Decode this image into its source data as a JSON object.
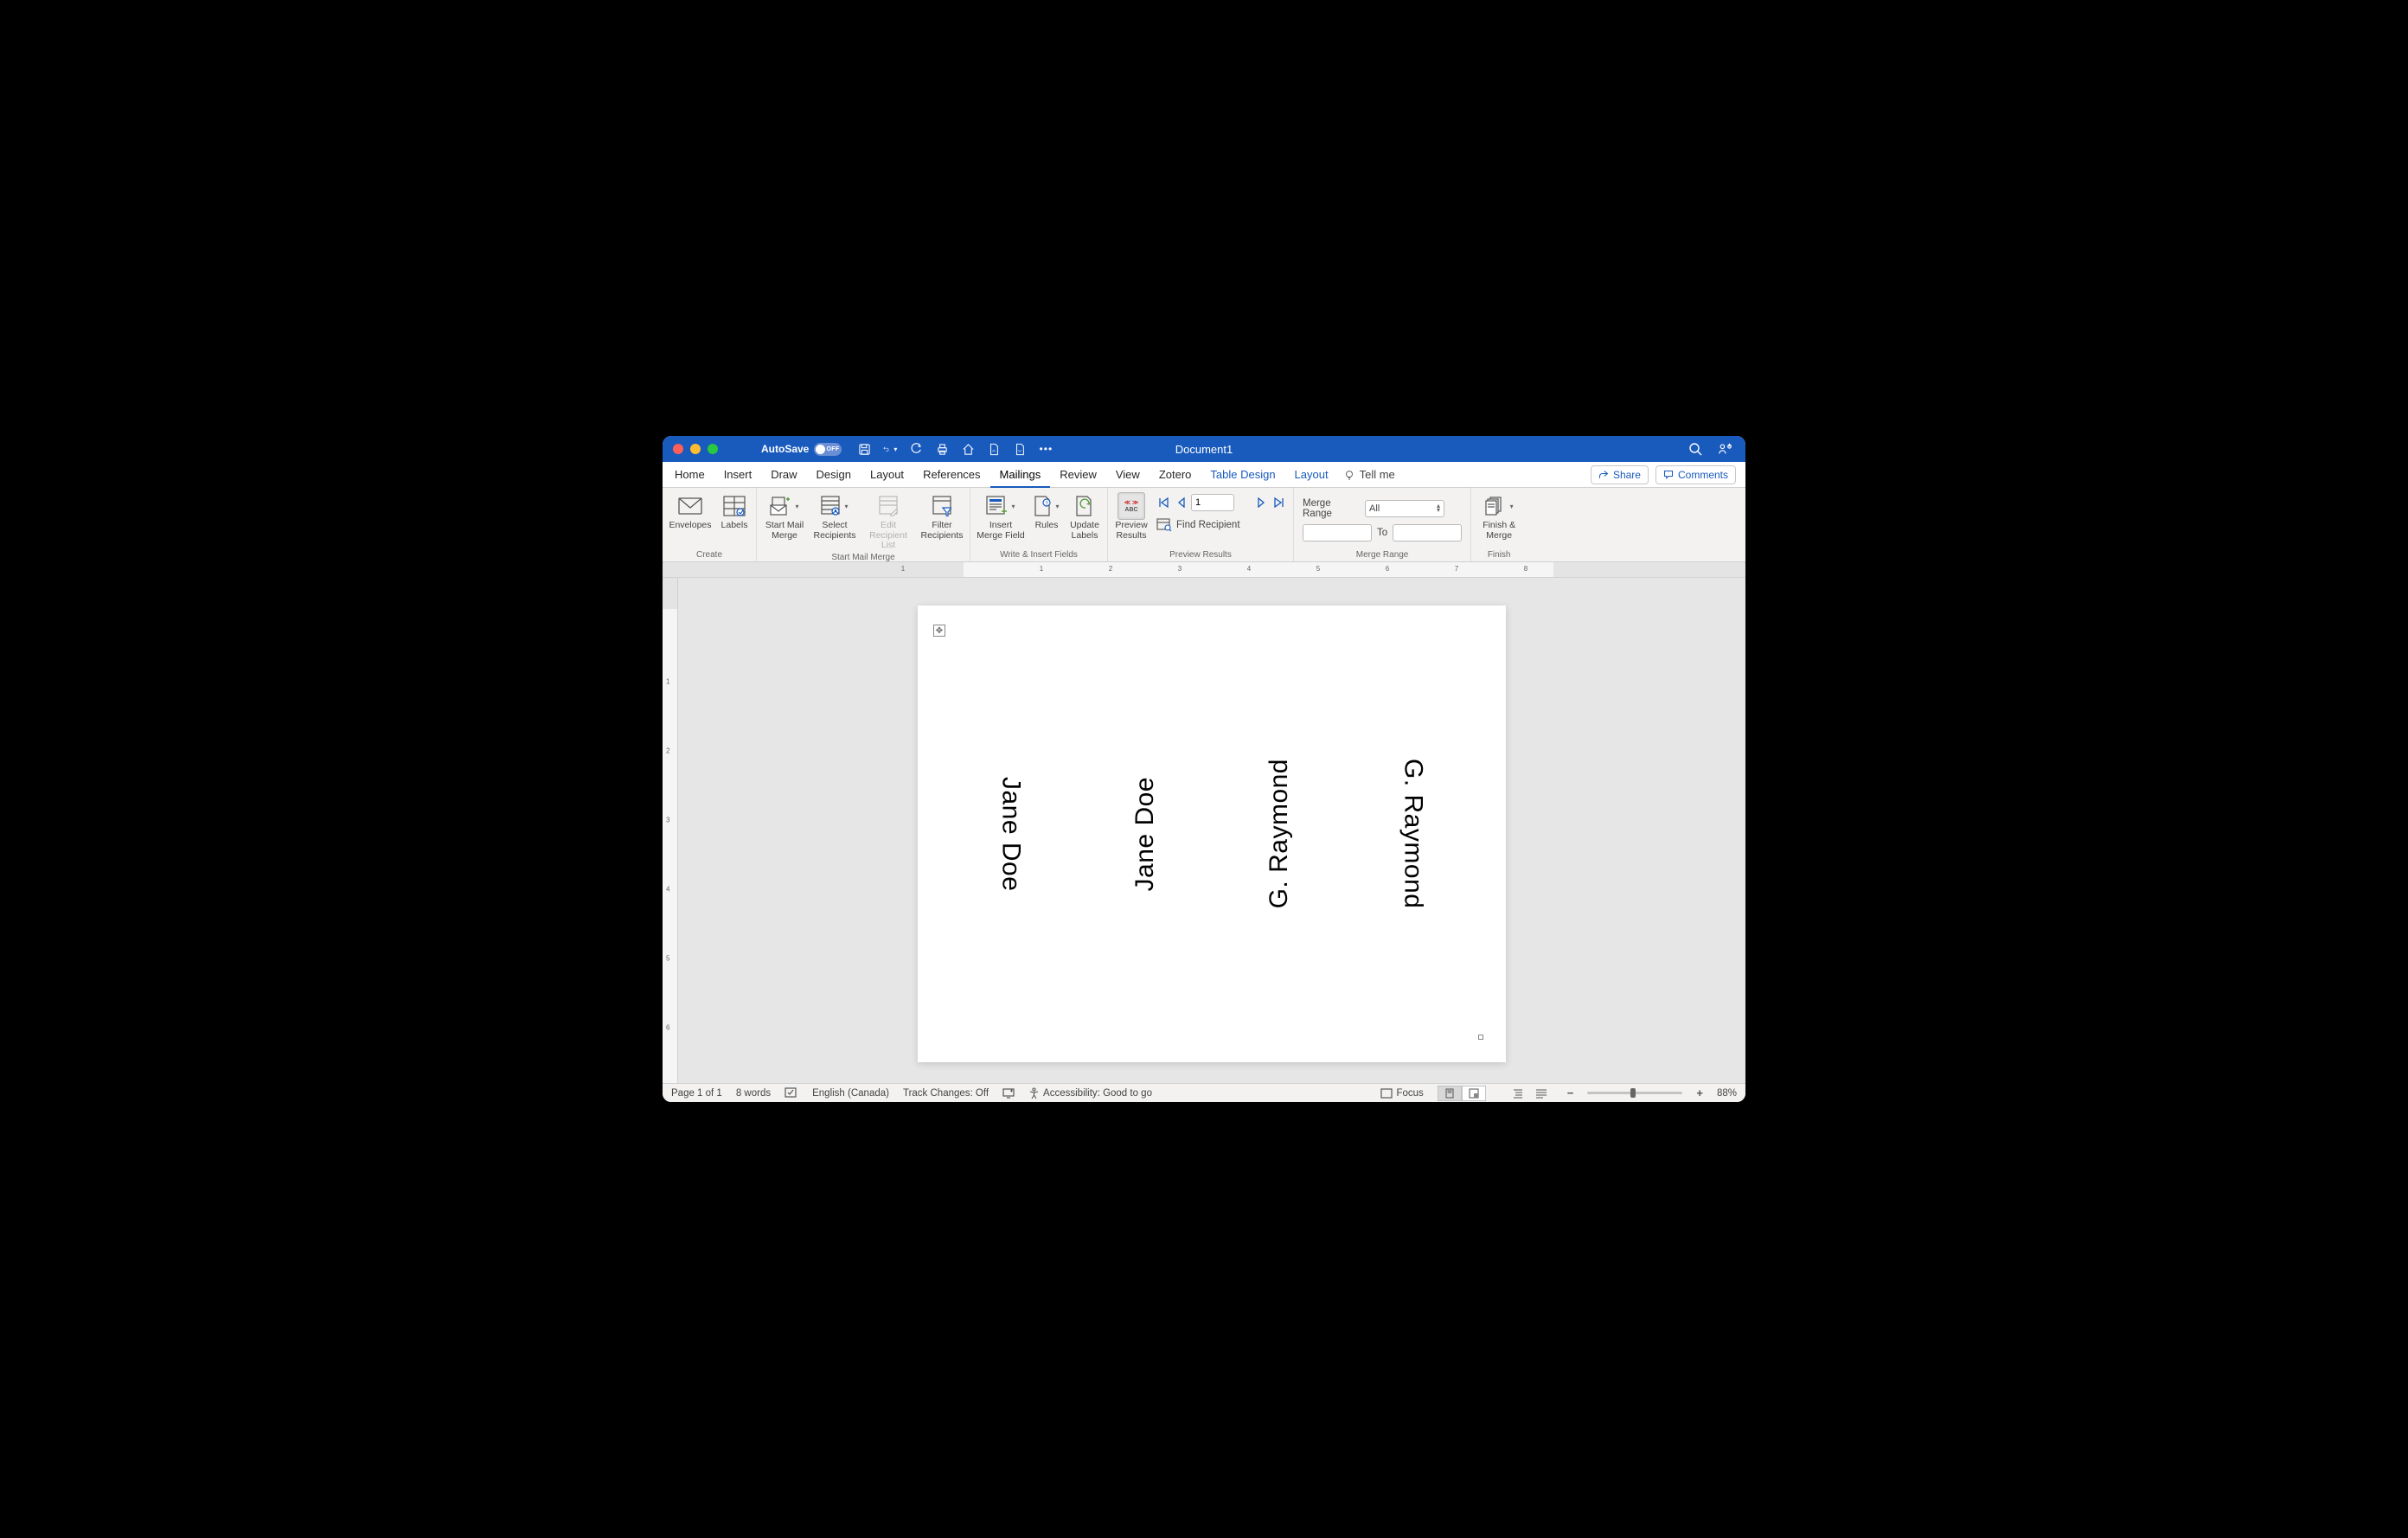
{
  "titlebar": {
    "autosave_label": "AutoSave",
    "autosave_state": "OFF",
    "document_title": "Document1"
  },
  "tabs": {
    "items": [
      "Home",
      "Insert",
      "Draw",
      "Design",
      "Layout",
      "References",
      "Mailings",
      "Review",
      "View",
      "Zotero",
      "Table Design",
      "Layout"
    ],
    "active_index": 6,
    "context_indices": [
      10,
      11
    ],
    "tellme": "Tell me"
  },
  "ribbon_right": {
    "share": "Share",
    "comments": "Comments"
  },
  "ribbon": {
    "group_create": {
      "label": "Create",
      "envelopes": "Envelopes",
      "labels": "Labels"
    },
    "group_start": {
      "label": "Start Mail Merge",
      "start_mail_merge": "Start Mail Merge",
      "select_recipients": "Select Recipients",
      "edit_recipient_list": "Edit Recipient List",
      "filter_recipients": "Filter Recipients"
    },
    "group_write": {
      "label": "Write & Insert Fields",
      "insert_merge_field": "Insert Merge Field",
      "rules": "Rules",
      "update_labels": "Update Labels"
    },
    "group_preview": {
      "label": "Preview Results",
      "preview_results": "Preview Results",
      "find_recipient": "Find Recipient",
      "record_number": "1"
    },
    "group_range": {
      "label": "Merge Range",
      "merge_range": "Merge Range",
      "all": "All",
      "to": "To"
    },
    "group_finish": {
      "label": "Finish",
      "finish_merge": "Finish & Merge"
    }
  },
  "document": {
    "cells": [
      "Jane Doe",
      "Jane Doe",
      "G. Raymond",
      "G. Raymond"
    ],
    "rotations": [
      "cw",
      "ccw",
      "ccw",
      "cw"
    ]
  },
  "statusbar": {
    "page": "Page 1 of 1",
    "words": "8 words",
    "language": "English (Canada)",
    "track_changes": "Track Changes: Off",
    "accessibility": "Accessibility: Good to go",
    "focus": "Focus",
    "zoom": "88%"
  }
}
